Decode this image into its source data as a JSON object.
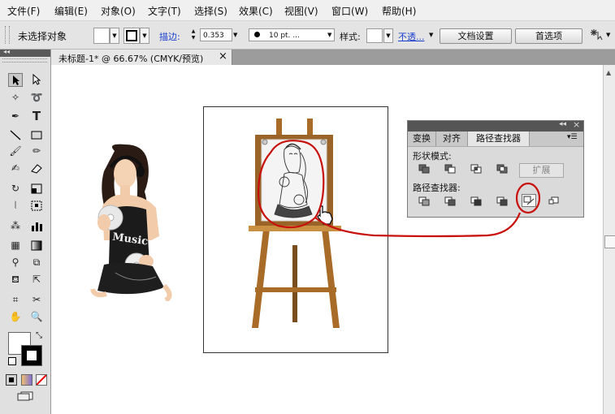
{
  "menu": [
    "文件(F)",
    "编辑(E)",
    "对象(O)",
    "文字(T)",
    "选择(S)",
    "效果(C)",
    "视图(V)",
    "窗口(W)",
    "帮助(H)"
  ],
  "control": {
    "selection_status": "未选择对象",
    "stroke_label": "描边:",
    "stroke_value": "0.353",
    "brush_value": "10 pt. ...",
    "style_label": "样式:",
    "opacity_label": "不透...",
    "doc_setup_button": "文档设置",
    "preferences_button": "首选项"
  },
  "document_tab": {
    "title": "未标题-1* @ 66.67% (CMYK/预览)",
    "close": "×"
  },
  "panel": {
    "tabs": [
      "变换",
      "对齐",
      "路径查找器"
    ],
    "shape_modes_label": "形状模式:",
    "expand_button": "扩展",
    "pathfinders_label": "路径查找器:"
  },
  "artwork": {
    "shirt_text": "Music"
  },
  "colors": {
    "annotation_red": "#c8100c",
    "easel_wood": "#a86c28",
    "link_blue": "#1a3fd0"
  }
}
